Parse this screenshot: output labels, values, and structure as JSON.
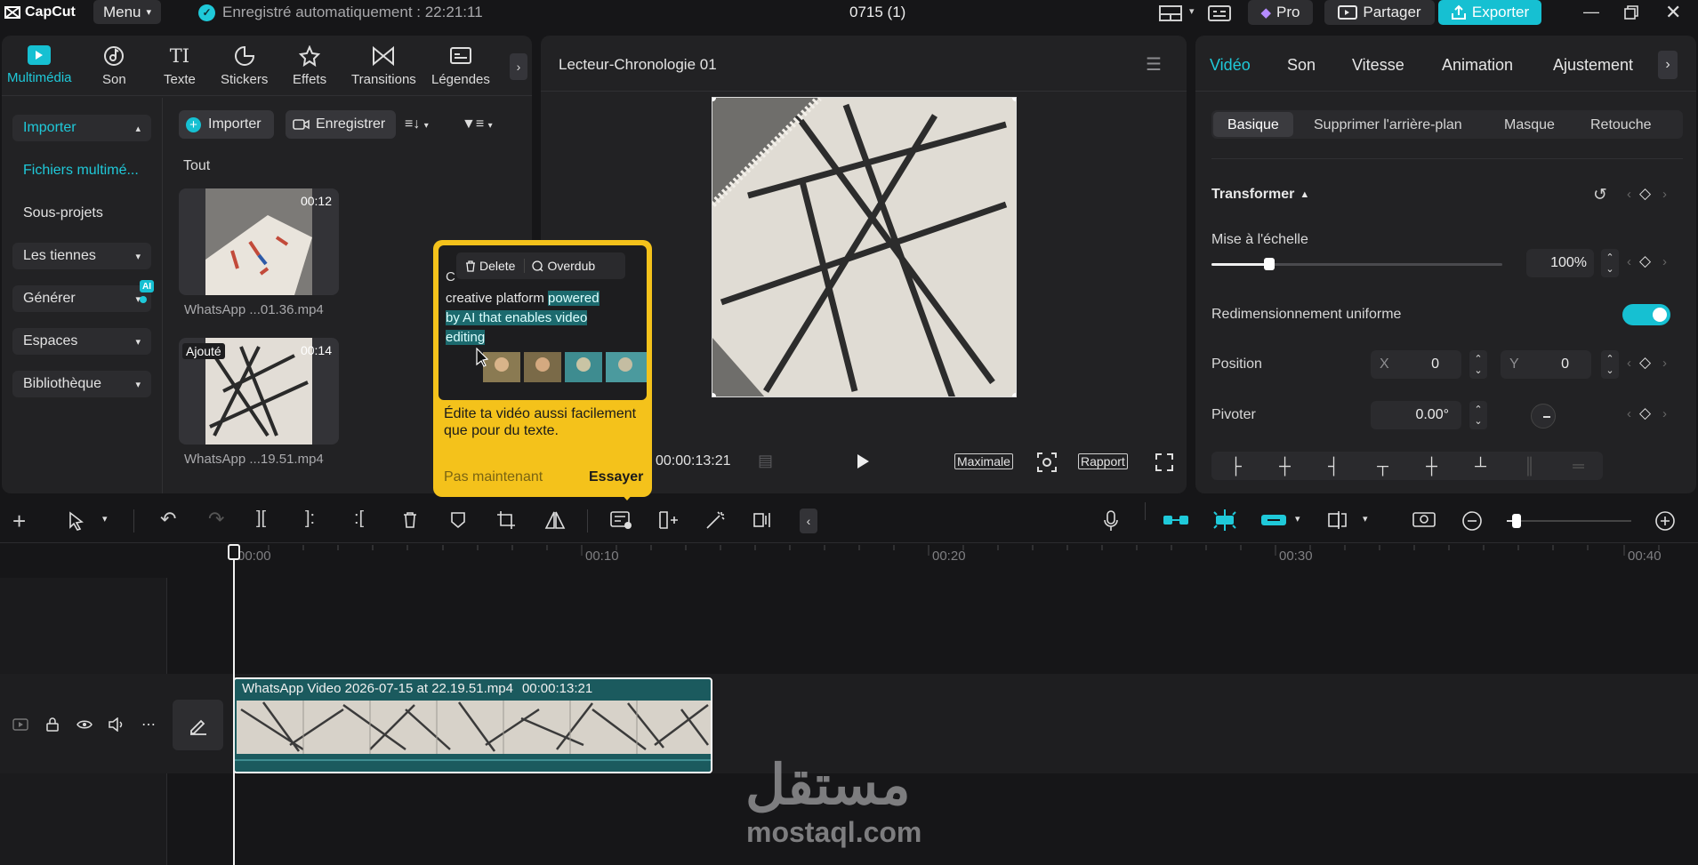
{
  "titlebar": {
    "app_name": "CapCut",
    "menu_label": "Menu",
    "autosave": "Enregistré automatiquement : 22:21:11",
    "project_name": "0715 (1)",
    "pro_label": "Pro",
    "share_label": "Partager",
    "export_label": "Exporter"
  },
  "toolbar": {
    "tabs": [
      {
        "label": "Multimédia",
        "icon": "media-icon"
      },
      {
        "label": "Son",
        "icon": "music-icon"
      },
      {
        "label": "Texte",
        "icon": "text-icon"
      },
      {
        "label": "Stickers",
        "icon": "sticker-icon"
      },
      {
        "label": "Effets",
        "icon": "effects-icon"
      },
      {
        "label": "Transitions",
        "icon": "transitions-icon"
      },
      {
        "label": "Légendes",
        "icon": "captions-icon"
      }
    ]
  },
  "sidebar": {
    "import": "Importer",
    "media_files": "Fichiers multimé...",
    "subprojects": "Sous-projets",
    "yours": "Les tiennes",
    "generate": "Générer",
    "ai_badge": "AI",
    "spaces": "Espaces",
    "library": "Bibliothèque"
  },
  "media": {
    "import_button": "Importer",
    "record_button": "Enregistrer",
    "filter_all": "Tout",
    "items": [
      {
        "duration": "00:12",
        "name": "WhatsApp ...01.36.mp4",
        "badge": ""
      },
      {
        "duration": "00:14",
        "name": "WhatsApp ...19.51.mp4",
        "badge": "Ajouté"
      }
    ]
  },
  "popup": {
    "delete": "Delete",
    "overdub": "Overdub",
    "text_c": "C",
    "text_line1a": "creative platform ",
    "text_line1b": "powered",
    "text_line2": "by AI that enables video",
    "text_line3": "editing",
    "description": "Édite ta vidéo aussi facilement que pour du texte.",
    "not_now": "Pas maintenant",
    "try": "Essayer"
  },
  "player": {
    "title": "Lecteur-Chronologie 01",
    "timecode": "00:00:13:21",
    "quality_label": "Maximale",
    "ratio_label": "Rapport"
  },
  "inspector": {
    "tabs": [
      "Vidéo",
      "Son",
      "Vitesse",
      "Animation",
      "Ajustement"
    ],
    "subtabs": [
      "Basique",
      "Supprimer l'arrière-plan",
      "Masque",
      "Retouche"
    ],
    "transform": "Transformer",
    "scale_label": "Mise à l'échelle",
    "scale_value": "100%",
    "scale_fraction": 0.2,
    "uniform_label": "Redimensionnement uniforme",
    "uniform_on": true,
    "position_label": "Position",
    "x_label": "X",
    "x_value": "0",
    "y_label": "Y",
    "y_value": "0",
    "rotate_label": "Pivoter",
    "rotate_value": "0.00°"
  },
  "timeline": {
    "ruler": [
      "00:00",
      "00:10",
      "00:20",
      "00:30",
      "00:40"
    ],
    "clip_name": "WhatsApp Video 2026-07-15 at 22.19.51.mp4",
    "clip_duration": "00:00:13:21"
  },
  "watermark": {
    "arabic": "مستقل",
    "latin": "mostaql.com"
  },
  "colors": {
    "accent": "#1fc9d9",
    "popup_yellow": "#f4c21b",
    "clip_teal": "#1b5a5e"
  }
}
